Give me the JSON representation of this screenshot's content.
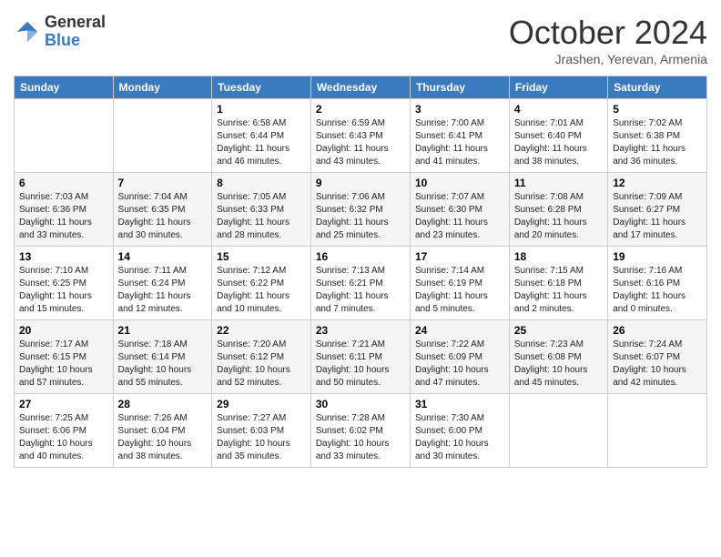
{
  "header": {
    "logo_general": "General",
    "logo_blue": "Blue",
    "month_title": "October 2024",
    "subtitle": "Jrashen, Yerevan, Armenia"
  },
  "weekdays": [
    "Sunday",
    "Monday",
    "Tuesday",
    "Wednesday",
    "Thursday",
    "Friday",
    "Saturday"
  ],
  "weeks": [
    [
      {
        "day": "",
        "sunrise": "",
        "sunset": "",
        "daylight": ""
      },
      {
        "day": "",
        "sunrise": "",
        "sunset": "",
        "daylight": ""
      },
      {
        "day": "1",
        "sunrise": "Sunrise: 6:58 AM",
        "sunset": "Sunset: 6:44 PM",
        "daylight": "Daylight: 11 hours and 46 minutes."
      },
      {
        "day": "2",
        "sunrise": "Sunrise: 6:59 AM",
        "sunset": "Sunset: 6:43 PM",
        "daylight": "Daylight: 11 hours and 43 minutes."
      },
      {
        "day": "3",
        "sunrise": "Sunrise: 7:00 AM",
        "sunset": "Sunset: 6:41 PM",
        "daylight": "Daylight: 11 hours and 41 minutes."
      },
      {
        "day": "4",
        "sunrise": "Sunrise: 7:01 AM",
        "sunset": "Sunset: 6:40 PM",
        "daylight": "Daylight: 11 hours and 38 minutes."
      },
      {
        "day": "5",
        "sunrise": "Sunrise: 7:02 AM",
        "sunset": "Sunset: 6:38 PM",
        "daylight": "Daylight: 11 hours and 36 minutes."
      }
    ],
    [
      {
        "day": "6",
        "sunrise": "Sunrise: 7:03 AM",
        "sunset": "Sunset: 6:36 PM",
        "daylight": "Daylight: 11 hours and 33 minutes."
      },
      {
        "day": "7",
        "sunrise": "Sunrise: 7:04 AM",
        "sunset": "Sunset: 6:35 PM",
        "daylight": "Daylight: 11 hours and 30 minutes."
      },
      {
        "day": "8",
        "sunrise": "Sunrise: 7:05 AM",
        "sunset": "Sunset: 6:33 PM",
        "daylight": "Daylight: 11 hours and 28 minutes."
      },
      {
        "day": "9",
        "sunrise": "Sunrise: 7:06 AM",
        "sunset": "Sunset: 6:32 PM",
        "daylight": "Daylight: 11 hours and 25 minutes."
      },
      {
        "day": "10",
        "sunrise": "Sunrise: 7:07 AM",
        "sunset": "Sunset: 6:30 PM",
        "daylight": "Daylight: 11 hours and 23 minutes."
      },
      {
        "day": "11",
        "sunrise": "Sunrise: 7:08 AM",
        "sunset": "Sunset: 6:28 PM",
        "daylight": "Daylight: 11 hours and 20 minutes."
      },
      {
        "day": "12",
        "sunrise": "Sunrise: 7:09 AM",
        "sunset": "Sunset: 6:27 PM",
        "daylight": "Daylight: 11 hours and 17 minutes."
      }
    ],
    [
      {
        "day": "13",
        "sunrise": "Sunrise: 7:10 AM",
        "sunset": "Sunset: 6:25 PM",
        "daylight": "Daylight: 11 hours and 15 minutes."
      },
      {
        "day": "14",
        "sunrise": "Sunrise: 7:11 AM",
        "sunset": "Sunset: 6:24 PM",
        "daylight": "Daylight: 11 hours and 12 minutes."
      },
      {
        "day": "15",
        "sunrise": "Sunrise: 7:12 AM",
        "sunset": "Sunset: 6:22 PM",
        "daylight": "Daylight: 11 hours and 10 minutes."
      },
      {
        "day": "16",
        "sunrise": "Sunrise: 7:13 AM",
        "sunset": "Sunset: 6:21 PM",
        "daylight": "Daylight: 11 hours and 7 minutes."
      },
      {
        "day": "17",
        "sunrise": "Sunrise: 7:14 AM",
        "sunset": "Sunset: 6:19 PM",
        "daylight": "Daylight: 11 hours and 5 minutes."
      },
      {
        "day": "18",
        "sunrise": "Sunrise: 7:15 AM",
        "sunset": "Sunset: 6:18 PM",
        "daylight": "Daylight: 11 hours and 2 minutes."
      },
      {
        "day": "19",
        "sunrise": "Sunrise: 7:16 AM",
        "sunset": "Sunset: 6:16 PM",
        "daylight": "Daylight: 11 hours and 0 minutes."
      }
    ],
    [
      {
        "day": "20",
        "sunrise": "Sunrise: 7:17 AM",
        "sunset": "Sunset: 6:15 PM",
        "daylight": "Daylight: 10 hours and 57 minutes."
      },
      {
        "day": "21",
        "sunrise": "Sunrise: 7:18 AM",
        "sunset": "Sunset: 6:14 PM",
        "daylight": "Daylight: 10 hours and 55 minutes."
      },
      {
        "day": "22",
        "sunrise": "Sunrise: 7:20 AM",
        "sunset": "Sunset: 6:12 PM",
        "daylight": "Daylight: 10 hours and 52 minutes."
      },
      {
        "day": "23",
        "sunrise": "Sunrise: 7:21 AM",
        "sunset": "Sunset: 6:11 PM",
        "daylight": "Daylight: 10 hours and 50 minutes."
      },
      {
        "day": "24",
        "sunrise": "Sunrise: 7:22 AM",
        "sunset": "Sunset: 6:09 PM",
        "daylight": "Daylight: 10 hours and 47 minutes."
      },
      {
        "day": "25",
        "sunrise": "Sunrise: 7:23 AM",
        "sunset": "Sunset: 6:08 PM",
        "daylight": "Daylight: 10 hours and 45 minutes."
      },
      {
        "day": "26",
        "sunrise": "Sunrise: 7:24 AM",
        "sunset": "Sunset: 6:07 PM",
        "daylight": "Daylight: 10 hours and 42 minutes."
      }
    ],
    [
      {
        "day": "27",
        "sunrise": "Sunrise: 7:25 AM",
        "sunset": "Sunset: 6:06 PM",
        "daylight": "Daylight: 10 hours and 40 minutes."
      },
      {
        "day": "28",
        "sunrise": "Sunrise: 7:26 AM",
        "sunset": "Sunset: 6:04 PM",
        "daylight": "Daylight: 10 hours and 38 minutes."
      },
      {
        "day": "29",
        "sunrise": "Sunrise: 7:27 AM",
        "sunset": "Sunset: 6:03 PM",
        "daylight": "Daylight: 10 hours and 35 minutes."
      },
      {
        "day": "30",
        "sunrise": "Sunrise: 7:28 AM",
        "sunset": "Sunset: 6:02 PM",
        "daylight": "Daylight: 10 hours and 33 minutes."
      },
      {
        "day": "31",
        "sunrise": "Sunrise: 7:30 AM",
        "sunset": "Sunset: 6:00 PM",
        "daylight": "Daylight: 10 hours and 30 minutes."
      },
      {
        "day": "",
        "sunrise": "",
        "sunset": "",
        "daylight": ""
      },
      {
        "day": "",
        "sunrise": "",
        "sunset": "",
        "daylight": ""
      }
    ]
  ]
}
